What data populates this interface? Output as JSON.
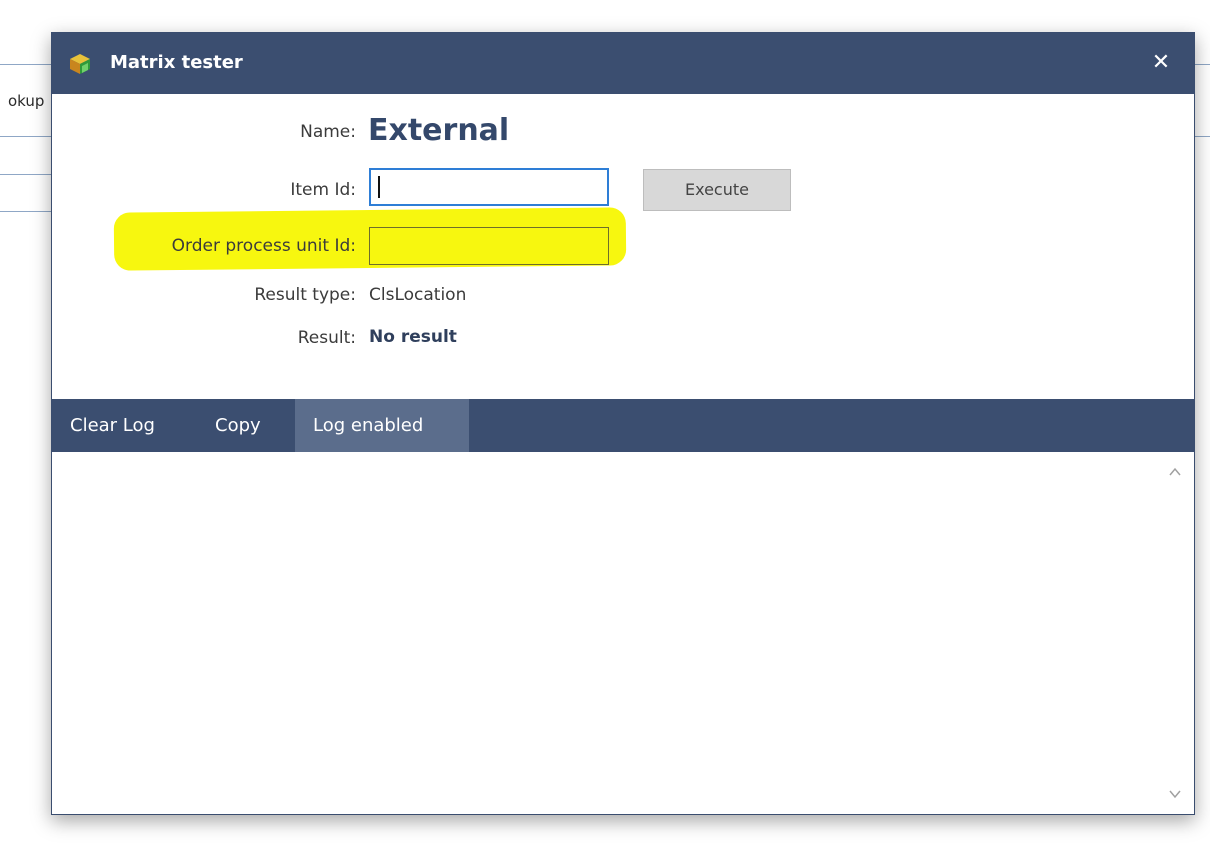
{
  "background": {
    "partial_text": "okup"
  },
  "dialog": {
    "title": "Matrix tester",
    "close_symbol": "✕",
    "icon": "app-cube-icon"
  },
  "form": {
    "name_label": "Name:",
    "name_value": "External",
    "item_id_label": "Item Id:",
    "item_id_value": "",
    "order_process_label": "Order process unit Id:",
    "order_process_value": "",
    "execute_label": "Execute",
    "result_type_label": "Result type:",
    "result_type_value": "ClsLocation",
    "result_label": "Result:",
    "result_value": "No result",
    "highlight_color": "#f7f70f"
  },
  "toolbar": {
    "clear_log": "Clear Log",
    "copy": "Copy",
    "log_enabled": "Log enabled"
  },
  "log": {
    "content": ""
  },
  "colors": {
    "header": "#3b4e70",
    "accent_name": "#34486b",
    "active_tab": "#5b6d8c"
  }
}
